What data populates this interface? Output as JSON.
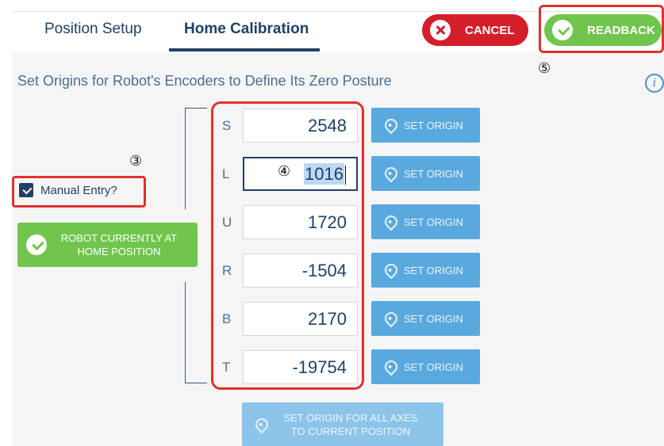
{
  "tabs": [
    {
      "label": "Position Setup",
      "active": false
    },
    {
      "label": "Home Calibration",
      "active": true
    }
  ],
  "header": {
    "cancel_label": "CANCEL",
    "readback_label": "READBACK"
  },
  "annotations": {
    "n3": "③",
    "n4": "④",
    "n5": "⑤"
  },
  "page_title": "Set Origins for Robot's Encoders to Define Its Zero Posture",
  "info_icon": "i",
  "manual_entry": {
    "label": "Manual Entry?",
    "checked": true
  },
  "home_button": {
    "line1": "ROBOT CURRENTLY AT",
    "line2": "HOME POSITION"
  },
  "axes": [
    {
      "label": "S",
      "value": "2548",
      "button": "SET ORIGIN"
    },
    {
      "label": "L",
      "value": "1016",
      "button": "SET ORIGIN",
      "focused": true
    },
    {
      "label": "U",
      "value": "1720",
      "button": "SET ORIGIN"
    },
    {
      "label": "R",
      "value": "-1504",
      "button": "SET ORIGIN"
    },
    {
      "label": "B",
      "value": "2170",
      "button": "SET ORIGIN"
    },
    {
      "label": "T",
      "value": "-19754",
      "button": "SET ORIGIN"
    }
  ],
  "set_all": {
    "line1": "SET ORIGIN FOR ALL AXES",
    "line2": "TO CURRENT POSITION"
  },
  "colors": {
    "primary": "#1f4167",
    "cancel": "#d41f2a",
    "success": "#71c54d",
    "set_origin": "#5aa9de",
    "highlight": "#e03030"
  }
}
